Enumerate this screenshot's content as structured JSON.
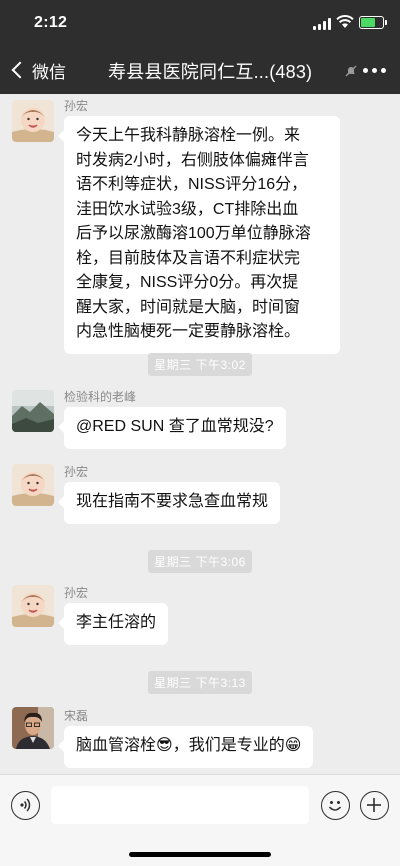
{
  "status_bar": {
    "time": "2:12"
  },
  "nav": {
    "back_label": "微信",
    "title": "寿县县医院同仁互...(483)"
  },
  "messages": [
    {
      "sender": "孙宏",
      "avatar": "baby-avatar",
      "lines": [
        "今天上午我科静脉溶栓一例。来",
        "时发病2小时，右侧肢体偏瘫伴言",
        "语不利等症状，NISS评分16分，",
        "洼田饮水试验3级，CT排除出血",
        "后予以尿激酶溶100万单位静脉溶",
        "栓，目前肢体及言语不利症状完",
        "全康复，NISS评分0分。再次提",
        "醒大家，时间就是大脑，时间窗",
        "内急性脑梗死一定要静脉溶栓。"
      ]
    },
    {
      "timestamp": "星期三 下午3:02"
    },
    {
      "sender": "检验科的老峰",
      "avatar": "landscape-avatar",
      "lines": [
        "@RED SUN 查了血常规没?"
      ]
    },
    {
      "sender": "孙宏",
      "avatar": "baby-avatar",
      "lines": [
        "现在指南不要求急查血常规"
      ]
    },
    {
      "timestamp": "星期三 下午3:06"
    },
    {
      "sender": "孙宏",
      "avatar": "baby-avatar",
      "lines": [
        "李主任溶的"
      ]
    },
    {
      "timestamp": "星期三 下午3:13"
    },
    {
      "sender": "宋磊",
      "avatar": "man-avatar",
      "text_before": "脑血管溶栓",
      "emoji1": "😎",
      "text_after": "，我们是专业的",
      "emoji2": "😁"
    }
  ],
  "input": {
    "value": "",
    "placeholder": ""
  },
  "colors": {
    "header_bg": "#2e2e2e",
    "chat_bg": "#ededed",
    "bubble_bg": "#ffffff",
    "timestamp_bg": "#d9d9d9"
  }
}
